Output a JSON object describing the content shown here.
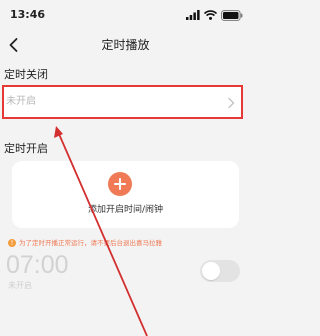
{
  "status_bar": {
    "time": "13:46"
  },
  "nav": {
    "title": "定时播放"
  },
  "timer_off": {
    "section_label": "定时关闭",
    "status": "未开启"
  },
  "timer_on": {
    "section_label": "定时开启",
    "add_label": "添加开启时间/闹钟",
    "notice": "为了定时开播正常运行，请不要后台退出喜马拉雅",
    "item": {
      "time": "07:00",
      "status": "未开启",
      "enabled": false
    }
  },
  "colors": {
    "highlight_border": "#e53935",
    "accent": "#f07a55",
    "notice_icon": "#f39c3d",
    "background": "#f3f3f3"
  },
  "icons": {
    "back": "chevron-left-icon",
    "row_arrow": "chevron-right-icon",
    "add": "plus-circle-icon",
    "notice": "info-icon",
    "annotation": "arrow-icon"
  }
}
